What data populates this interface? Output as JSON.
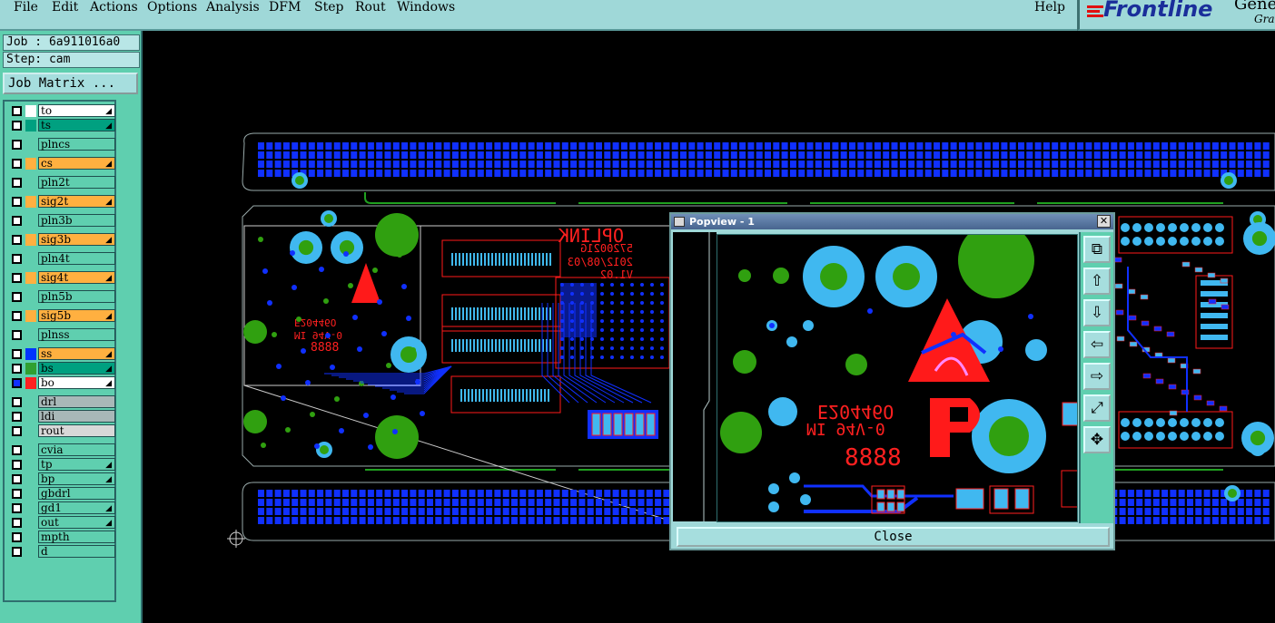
{
  "menubar": {
    "items": [
      {
        "label": "File",
        "ul": "F"
      },
      {
        "label": "Edit",
        "ul": "E"
      },
      {
        "label": "Actions",
        "ul": "A"
      },
      {
        "label": "Options",
        "ul": "O"
      },
      {
        "label": "Analysis",
        "ul": "A"
      },
      {
        "label": "DFM",
        "ul": "D"
      },
      {
        "label": "Step",
        "ul": "S"
      },
      {
        "label": "Rout",
        "ul": "R"
      },
      {
        "label": "Windows",
        "ul": "W"
      }
    ],
    "help": "Help"
  },
  "logo": {
    "brand": "Frontline",
    "product": "Gene",
    "sub": "Grap"
  },
  "job": {
    "label": "Job : 6a911016a0",
    "step": "Step: cam",
    "matrix_button": "Job Matrix ..."
  },
  "layers": [
    {
      "name": "to",
      "color": "#ffffff",
      "name_bg": "#ffffff",
      "checked": false,
      "arrow": true
    },
    {
      "name": "ts",
      "color": "#00a080",
      "name_bg": "#00a080",
      "checked": false,
      "arrow": true
    },
    {
      "name": "plncs",
      "color": "",
      "name_bg": "#5fcfaf",
      "checked": false,
      "arrow": false
    },
    {
      "name": "cs",
      "color": "#ffb040",
      "name_bg": "#ffb040",
      "checked": false,
      "arrow": true
    },
    {
      "name": "pln2t",
      "color": "",
      "name_bg": "#5fcfaf",
      "checked": false,
      "arrow": false
    },
    {
      "name": "sig2t",
      "color": "#ffb040",
      "name_bg": "#ffb040",
      "checked": false,
      "arrow": true
    },
    {
      "name": "pln3b",
      "color": "",
      "name_bg": "#5fcfaf",
      "checked": false,
      "arrow": false
    },
    {
      "name": "sig3b",
      "color": "#ffb040",
      "name_bg": "#ffb040",
      "checked": false,
      "arrow": true
    },
    {
      "name": "pln4t",
      "color": "",
      "name_bg": "#5fcfaf",
      "checked": false,
      "arrow": false
    },
    {
      "name": "sig4t",
      "color": "#ffb040",
      "name_bg": "#ffb040",
      "checked": false,
      "arrow": true
    },
    {
      "name": "pln5b",
      "color": "",
      "name_bg": "#5fcfaf",
      "checked": false,
      "arrow": false
    },
    {
      "name": "sig5b",
      "color": "#ffb040",
      "name_bg": "#ffb040",
      "checked": false,
      "arrow": true
    },
    {
      "name": "plnss",
      "color": "",
      "name_bg": "#5fcfaf",
      "checked": false,
      "arrow": false
    },
    {
      "name": "ss",
      "color": "#0033ff",
      "name_bg": "#ffb040",
      "checked": false,
      "arrow": true
    },
    {
      "name": "bs",
      "color": "#30a030",
      "name_bg": "#00a080",
      "checked": false,
      "arrow": true
    },
    {
      "name": "bo",
      "color": "#ff2020",
      "name_bg": "#ffffff",
      "checked": true,
      "arrow": true
    },
    {
      "name": "drl",
      "color": "",
      "name_bg": "#a8b8b8",
      "checked": false,
      "arrow": false
    },
    {
      "name": "ldi",
      "color": "",
      "name_bg": "#a8b8b8",
      "checked": false,
      "arrow": false
    },
    {
      "name": "rout",
      "color": "",
      "name_bg": "#d8d8d8",
      "checked": false,
      "arrow": false
    },
    {
      "name": "cvia",
      "color": "",
      "name_bg": "#5fcfaf",
      "checked": false,
      "arrow": false
    },
    {
      "name": "tp",
      "color": "",
      "name_bg": "#5fcfaf",
      "checked": false,
      "arrow": true
    },
    {
      "name": "bp",
      "color": "",
      "name_bg": "#5fcfaf",
      "checked": false,
      "arrow": true
    },
    {
      "name": "gbdrl",
      "color": "",
      "name_bg": "#5fcfaf",
      "checked": false,
      "arrow": false
    },
    {
      "name": "gd1",
      "color": "",
      "name_bg": "#5fcfaf",
      "checked": false,
      "arrow": true
    },
    {
      "name": "out",
      "color": "",
      "name_bg": "#5fcfaf",
      "checked": false,
      "arrow": true
    },
    {
      "name": "mpth",
      "color": "",
      "name_bg": "#5fcfaf",
      "checked": false,
      "arrow": false
    },
    {
      "name": "d",
      "color": "",
      "name_bg": "#5fcfaf",
      "checked": false,
      "arrow": false
    }
  ],
  "pcb_text": {
    "brand": "OPLINK",
    "part": "E20446O",
    "rating": "MI 94V-0",
    "code": "8888",
    "date": "2012/08/03",
    "pn": "5720021G",
    "rev": "V1.02"
  },
  "popview": {
    "title": "Popview - 1",
    "close_label": "Close"
  },
  "colors": {
    "panel": "#5fcfaf",
    "menubar": "#9fd8d8",
    "copper_blue": "#1030ff",
    "pad_cyan": "#40b8f0",
    "via_green": "#30a010",
    "silk_red": "#ff1a1a"
  }
}
